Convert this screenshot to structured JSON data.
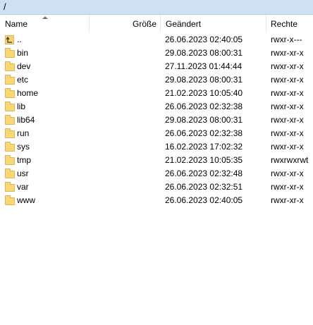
{
  "path": "/",
  "columns": {
    "name": "Name",
    "size": "Größe",
    "modified": "Geändert",
    "rights": "Rechte"
  },
  "sort": {
    "column": "name",
    "direction": "ascending"
  },
  "rows": [
    {
      "icon": "parent-directory-icon",
      "name": "..",
      "size": "",
      "modified": "26.06.2023 02:40:05",
      "rights": "rwxr-x---"
    },
    {
      "icon": "folder-icon",
      "name": "bin",
      "size": "",
      "modified": "29.08.2023 08:00:31",
      "rights": "rwxr-xr-x"
    },
    {
      "icon": "folder-icon",
      "name": "dev",
      "size": "",
      "modified": "27.11.2023 01:44:44",
      "rights": "rwxr-xr-x"
    },
    {
      "icon": "folder-icon",
      "name": "etc",
      "size": "",
      "modified": "29.08.2023 08:00:31",
      "rights": "rwxr-xr-x"
    },
    {
      "icon": "folder-icon",
      "name": "home",
      "size": "",
      "modified": "21.02.2023 10:05:40",
      "rights": "rwxr-xr-x"
    },
    {
      "icon": "folder-icon",
      "name": "lib",
      "size": "",
      "modified": "26.06.2023 02:32:38",
      "rights": "rwxr-xr-x"
    },
    {
      "icon": "folder-icon",
      "name": "lib64",
      "size": "",
      "modified": "29.08.2023 08:00:31",
      "rights": "rwxr-xr-x"
    },
    {
      "icon": "folder-icon",
      "name": "run",
      "size": "",
      "modified": "26.06.2023 02:32:38",
      "rights": "rwxr-xr-x"
    },
    {
      "icon": "folder-icon",
      "name": "sys",
      "size": "",
      "modified": "16.02.2023 17:02:32",
      "rights": "rwxr-xr-x"
    },
    {
      "icon": "folder-icon",
      "name": "tmp",
      "size": "",
      "modified": "21.02.2023 10:05:35",
      "rights": "rwxrwxrwt"
    },
    {
      "icon": "folder-icon",
      "name": "usr",
      "size": "",
      "modified": "26.06.2023 02:32:48",
      "rights": "rwxr-xr-x"
    },
    {
      "icon": "folder-icon",
      "name": "var",
      "size": "",
      "modified": "26.06.2023 02:32:51",
      "rights": "rwxr-xr-x"
    },
    {
      "icon": "folder-icon",
      "name": "www",
      "size": "",
      "modified": "26.06.2023 02:40:05",
      "rights": "rwxr-xr-x"
    }
  ],
  "colors": {
    "pathbar_bg": "#cfe0f2",
    "folder_fill": "#f8d775",
    "folder_stroke": "#dcb554"
  }
}
